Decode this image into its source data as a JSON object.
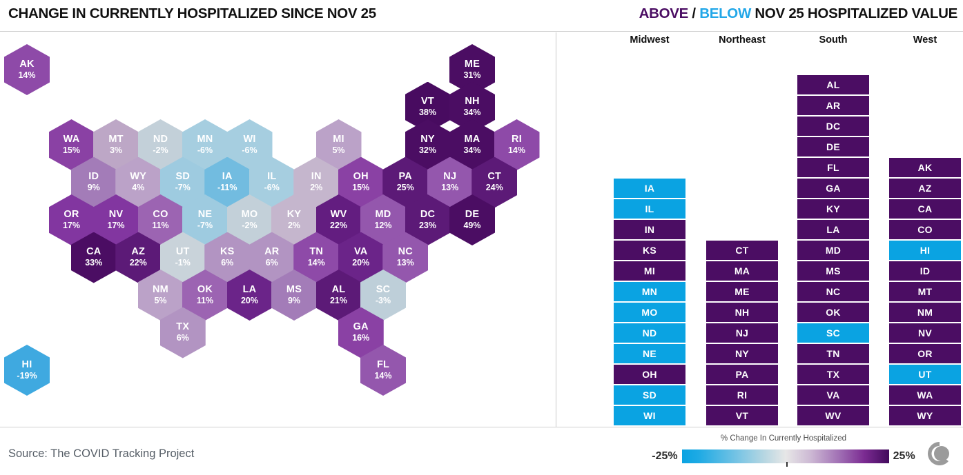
{
  "header": {
    "left_title": "CHANGE IN CURRENTLY HOSPITALIZED SINCE NOV 25",
    "right_above": "ABOVE",
    "right_slash": "/",
    "right_below": "BELOW",
    "right_rest": "NOV 25 HOSPITALIZED VALUE"
  },
  "footer": {
    "source": "Source: The COVID Tracking Project",
    "legend_caption": "% Change In Currently Hospitalized",
    "legend_min": "-25%",
    "legend_max": "25%",
    "logo_name": "covid-tracking-project-logo"
  },
  "colors": {
    "above": "#4b0d63",
    "below": "#0aa3e2",
    "gradient_low": "#0aa3e2",
    "gradient_mid": "#e7e7e7",
    "gradient_high": "#420a5c",
    "divider": "#c9c9c9"
  },
  "chart_data": {
    "type": "heatmap",
    "title": "CHANGE IN CURRENTLY HOSPITALIZED SINCE NOV 25",
    "subtitle": "ABOVE / BELOW NOV 25 HOSPITALIZED VALUE",
    "value_label": "% Change In Currently Hospitalized",
    "unit": "%",
    "colorbar": {
      "min": -25,
      "max": 25,
      "min_label": "-25%",
      "max_label": "25%",
      "tick_at": 0
    },
    "legend_position": "bottom-right",
    "grid": false,
    "tilemap_layout": "hex-tile-grid-us-states",
    "hexes": [
      {
        "abbr": "AK",
        "value": 14,
        "label": "14%",
        "fill": "#8e4aa8",
        "col": 0,
        "row": 0
      },
      {
        "abbr": "ME",
        "value": 31,
        "label": "31%",
        "fill": "#4b0d63",
        "col": 10,
        "row": 0
      },
      {
        "abbr": "VT",
        "value": 38,
        "label": "38%",
        "fill": "#480b60",
        "col": 9,
        "row": 1
      },
      {
        "abbr": "NH",
        "value": 34,
        "label": "34%",
        "fill": "#4b0d63",
        "col": 10,
        "row": 1
      },
      {
        "abbr": "WA",
        "value": 15,
        "label": "15%",
        "fill": "#8a41a4",
        "col": 1,
        "row": 2
      },
      {
        "abbr": "MT",
        "value": 3,
        "label": "3%",
        "fill": "#bda7c6",
        "col": 2,
        "row": 2
      },
      {
        "abbr": "ND",
        "value": -2,
        "label": "-2%",
        "fill": "#c3d0d9",
        "col": 3,
        "row": 2
      },
      {
        "abbr": "MN",
        "value": -6,
        "label": "-6%",
        "fill": "#a6cee0",
        "col": 4,
        "row": 2
      },
      {
        "abbr": "WI",
        "value": -6,
        "label": "-6%",
        "fill": "#a6cee0",
        "col": 5,
        "row": 2
      },
      {
        "abbr": "MI",
        "value": 5,
        "label": "5%",
        "fill": "#bba2c8",
        "col": 7,
        "row": 2
      },
      {
        "abbr": "NY",
        "value": 32,
        "label": "32%",
        "fill": "#4b0d63",
        "col": 9,
        "row": 2
      },
      {
        "abbr": "MA",
        "value": 34,
        "label": "34%",
        "fill": "#4b0d63",
        "col": 10,
        "row": 2
      },
      {
        "abbr": "RI",
        "value": 14,
        "label": "14%",
        "fill": "#8e4aa8",
        "col": 11,
        "row": 2
      },
      {
        "abbr": "ID",
        "value": 9,
        "label": "9%",
        "fill": "#a37cb8",
        "col": 1.5,
        "row": 3
      },
      {
        "abbr": "WY",
        "value": 4,
        "label": "4%",
        "fill": "#bba2c8",
        "col": 2.5,
        "row": 3
      },
      {
        "abbr": "SD",
        "value": -7,
        "label": "-7%",
        "fill": "#9ecbe0",
        "col": 3.5,
        "row": 3
      },
      {
        "abbr": "IA",
        "value": -11,
        "label": "-11%",
        "fill": "#72bce0",
        "col": 4.5,
        "row": 3
      },
      {
        "abbr": "IL",
        "value": -6,
        "label": "-6%",
        "fill": "#a6cee0",
        "col": 5.5,
        "row": 3
      },
      {
        "abbr": "IN",
        "value": 2,
        "label": "2%",
        "fill": "#c5b6cd",
        "col": 6.5,
        "row": 3
      },
      {
        "abbr": "OH",
        "value": 15,
        "label": "15%",
        "fill": "#8a41a4",
        "col": 7.5,
        "row": 3
      },
      {
        "abbr": "PA",
        "value": 25,
        "label": "25%",
        "fill": "#5c1a77",
        "col": 8.5,
        "row": 3
      },
      {
        "abbr": "NJ",
        "value": 13,
        "label": "13%",
        "fill": "#9457ad",
        "col": 9.5,
        "row": 3
      },
      {
        "abbr": "CT",
        "value": 24,
        "label": "24%",
        "fill": "#5c1a77",
        "col": 10.5,
        "row": 3
      },
      {
        "abbr": "OR",
        "value": 17,
        "label": "17%",
        "fill": "#8236a0",
        "col": 1,
        "row": 4
      },
      {
        "abbr": "NV",
        "value": 17,
        "label": "17%",
        "fill": "#8236a0",
        "col": 2,
        "row": 4
      },
      {
        "abbr": "CO",
        "value": 11,
        "label": "11%",
        "fill": "#9c64b2",
        "col": 3,
        "row": 4
      },
      {
        "abbr": "NE",
        "value": -7,
        "label": "-7%",
        "fill": "#9ecbe0",
        "col": 4,
        "row": 4
      },
      {
        "abbr": "MO",
        "value": -2,
        "label": "-2%",
        "fill": "#c3d0d9",
        "col": 5,
        "row": 4
      },
      {
        "abbr": "KY",
        "value": 2,
        "label": "2%",
        "fill": "#c5b6cd",
        "col": 6,
        "row": 4
      },
      {
        "abbr": "WV",
        "value": 22,
        "label": "22%",
        "fill": "#631d80",
        "col": 7,
        "row": 4
      },
      {
        "abbr": "MD",
        "value": 12,
        "label": "12%",
        "fill": "#9457ad",
        "col": 8,
        "row": 4
      },
      {
        "abbr": "DC",
        "value": 23,
        "label": "23%",
        "fill": "#5c1a77",
        "col": 9,
        "row": 4
      },
      {
        "abbr": "DE",
        "value": 49,
        "label": "49%",
        "fill": "#4b0d63",
        "col": 10,
        "row": 4
      },
      {
        "abbr": "CA",
        "value": 33,
        "label": "33%",
        "fill": "#4b0d63",
        "col": 1.5,
        "row": 5
      },
      {
        "abbr": "AZ",
        "value": 22,
        "label": "22%",
        "fill": "#5c1a77",
        "col": 2.5,
        "row": 5
      },
      {
        "abbr": "UT",
        "value": -1,
        "label": "-1%",
        "fill": "#c9d3da",
        "col": 3.5,
        "row": 5
      },
      {
        "abbr": "KS",
        "value": 6,
        "label": "6%",
        "fill": "#b294c2",
        "col": 4.5,
        "row": 5
      },
      {
        "abbr": "AR",
        "value": 6,
        "label": "6%",
        "fill": "#b294c2",
        "col": 5.5,
        "row": 5
      },
      {
        "abbr": "TN",
        "value": 14,
        "label": "14%",
        "fill": "#8e4aa8",
        "col": 6.5,
        "row": 5
      },
      {
        "abbr": "VA",
        "value": 20,
        "label": "20%",
        "fill": "#6b2489",
        "col": 7.5,
        "row": 5
      },
      {
        "abbr": "NC",
        "value": 13,
        "label": "13%",
        "fill": "#9457ad",
        "col": 8.5,
        "row": 5
      },
      {
        "abbr": "NM",
        "value": 5,
        "label": "5%",
        "fill": "#bba2c8",
        "col": 3,
        "row": 6
      },
      {
        "abbr": "OK",
        "value": 11,
        "label": "11%",
        "fill": "#9c64b2",
        "col": 4,
        "row": 6
      },
      {
        "abbr": "LA",
        "value": 20,
        "label": "20%",
        "fill": "#6b2489",
        "col": 5,
        "row": 6
      },
      {
        "abbr": "MS",
        "value": 9,
        "label": "9%",
        "fill": "#a37cb8",
        "col": 6,
        "row": 6
      },
      {
        "abbr": "AL",
        "value": 21,
        "label": "21%",
        "fill": "#5c1a77",
        "col": 7,
        "row": 6
      },
      {
        "abbr": "SC",
        "value": -3,
        "label": "-3%",
        "fill": "#becfd9",
        "col": 8,
        "row": 6
      },
      {
        "abbr": "TX",
        "value": 6,
        "label": "6%",
        "fill": "#b294c2",
        "col": 3.5,
        "row": 7
      },
      {
        "abbr": "GA",
        "value": 16,
        "label": "16%",
        "fill": "#8a41a4",
        "col": 7.5,
        "row": 7
      },
      {
        "abbr": "HI",
        "value": -19,
        "label": "-19%",
        "fill": "#3fa9e0",
        "col": 0,
        "row": 8
      },
      {
        "abbr": "FL",
        "value": 14,
        "label": "14%",
        "fill": "#9457ad",
        "col": 8,
        "row": 8
      }
    ]
  },
  "regions": [
    {
      "name": "Midwest",
      "states": [
        {
          "abbr": "IA",
          "status": "below"
        },
        {
          "abbr": "IL",
          "status": "below"
        },
        {
          "abbr": "IN",
          "status": "above"
        },
        {
          "abbr": "KS",
          "status": "above"
        },
        {
          "abbr": "MI",
          "status": "above"
        },
        {
          "abbr": "MN",
          "status": "below"
        },
        {
          "abbr": "MO",
          "status": "below"
        },
        {
          "abbr": "ND",
          "status": "below"
        },
        {
          "abbr": "NE",
          "status": "below"
        },
        {
          "abbr": "OH",
          "status": "above"
        },
        {
          "abbr": "SD",
          "status": "below"
        },
        {
          "abbr": "WI",
          "status": "below"
        }
      ]
    },
    {
      "name": "Northeast",
      "states": [
        {
          "abbr": "CT",
          "status": "above"
        },
        {
          "abbr": "MA",
          "status": "above"
        },
        {
          "abbr": "ME",
          "status": "above"
        },
        {
          "abbr": "NH",
          "status": "above"
        },
        {
          "abbr": "NJ",
          "status": "above"
        },
        {
          "abbr": "NY",
          "status": "above"
        },
        {
          "abbr": "PA",
          "status": "above"
        },
        {
          "abbr": "RI",
          "status": "above"
        },
        {
          "abbr": "VT",
          "status": "above"
        }
      ]
    },
    {
      "name": "South",
      "states": [
        {
          "abbr": "AL",
          "status": "above"
        },
        {
          "abbr": "AR",
          "status": "above"
        },
        {
          "abbr": "DC",
          "status": "above"
        },
        {
          "abbr": "DE",
          "status": "above"
        },
        {
          "abbr": "FL",
          "status": "above"
        },
        {
          "abbr": "GA",
          "status": "above"
        },
        {
          "abbr": "KY",
          "status": "above"
        },
        {
          "abbr": "LA",
          "status": "above"
        },
        {
          "abbr": "MD",
          "status": "above"
        },
        {
          "abbr": "MS",
          "status": "above"
        },
        {
          "abbr": "NC",
          "status": "above"
        },
        {
          "abbr": "OK",
          "status": "above"
        },
        {
          "abbr": "SC",
          "status": "below"
        },
        {
          "abbr": "TN",
          "status": "above"
        },
        {
          "abbr": "TX",
          "status": "above"
        },
        {
          "abbr": "VA",
          "status": "above"
        },
        {
          "abbr": "WV",
          "status": "above"
        }
      ]
    },
    {
      "name": "West",
      "states": [
        {
          "abbr": "AK",
          "status": "above"
        },
        {
          "abbr": "AZ",
          "status": "above"
        },
        {
          "abbr": "CA",
          "status": "above"
        },
        {
          "abbr": "CO",
          "status": "above"
        },
        {
          "abbr": "HI",
          "status": "below"
        },
        {
          "abbr": "ID",
          "status": "above"
        },
        {
          "abbr": "MT",
          "status": "above"
        },
        {
          "abbr": "NM",
          "status": "above"
        },
        {
          "abbr": "NV",
          "status": "above"
        },
        {
          "abbr": "OR",
          "status": "above"
        },
        {
          "abbr": "UT",
          "status": "below"
        },
        {
          "abbr": "WA",
          "status": "above"
        },
        {
          "abbr": "WY",
          "status": "above"
        }
      ]
    }
  ]
}
